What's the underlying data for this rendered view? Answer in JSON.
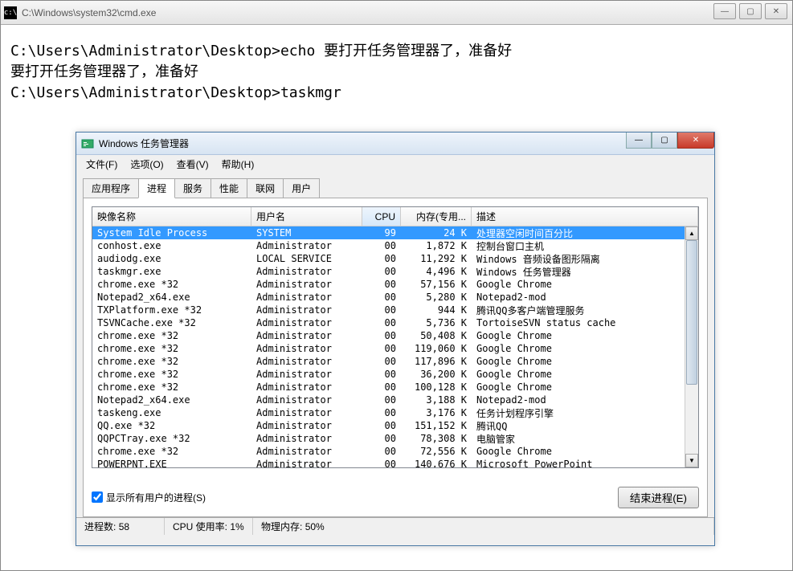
{
  "cmd": {
    "title": "C:\\Windows\\system32\\cmd.exe",
    "lines": [
      "",
      "C:\\Users\\Administrator\\Desktop>echo 要打开任务管理器了，准备好",
      "要打开任务管理器了，准备好",
      "",
      "C:\\Users\\Administrator\\Desktop>taskmgr"
    ]
  },
  "tm": {
    "title": "Windows 任务管理器",
    "menu": [
      "文件(F)",
      "选项(O)",
      "查看(V)",
      "帮助(H)"
    ],
    "tabs": [
      "应用程序",
      "进程",
      "服务",
      "性能",
      "联网",
      "用户"
    ],
    "active_tab": 1,
    "columns": {
      "name": "映像名称",
      "user": "用户名",
      "cpu": "CPU",
      "mem": "内存(专用...",
      "desc": "描述"
    },
    "rows": [
      {
        "name": "System Idle Process",
        "user": "SYSTEM",
        "cpu": "99",
        "mem": "24 K",
        "desc": "处理器空闲时间百分比",
        "selected": true
      },
      {
        "name": "conhost.exe",
        "user": "Administrator",
        "cpu": "00",
        "mem": "1,872 K",
        "desc": "控制台窗口主机"
      },
      {
        "name": "audiodg.exe",
        "user": "LOCAL SERVICE",
        "cpu": "00",
        "mem": "11,292 K",
        "desc": "Windows 音频设备图形隔离"
      },
      {
        "name": "taskmgr.exe",
        "user": "Administrator",
        "cpu": "00",
        "mem": "4,496 K",
        "desc": "Windows 任务管理器"
      },
      {
        "name": "chrome.exe *32",
        "user": "Administrator",
        "cpu": "00",
        "mem": "57,156 K",
        "desc": "Google Chrome"
      },
      {
        "name": "Notepad2_x64.exe",
        "user": "Administrator",
        "cpu": "00",
        "mem": "5,280 K",
        "desc": "Notepad2-mod"
      },
      {
        "name": "TXPlatform.exe *32",
        "user": "Administrator",
        "cpu": "00",
        "mem": "944 K",
        "desc": "腾讯QQ多客户端管理服务"
      },
      {
        "name": "TSVNCache.exe *32",
        "user": "Administrator",
        "cpu": "00",
        "mem": "5,736 K",
        "desc": "TortoiseSVN status cache"
      },
      {
        "name": "chrome.exe *32",
        "user": "Administrator",
        "cpu": "00",
        "mem": "50,408 K",
        "desc": "Google Chrome"
      },
      {
        "name": "chrome.exe *32",
        "user": "Administrator",
        "cpu": "00",
        "mem": "119,060 K",
        "desc": "Google Chrome"
      },
      {
        "name": "chrome.exe *32",
        "user": "Administrator",
        "cpu": "00",
        "mem": "117,896 K",
        "desc": "Google Chrome"
      },
      {
        "name": "chrome.exe *32",
        "user": "Administrator",
        "cpu": "00",
        "mem": "36,200 K",
        "desc": "Google Chrome"
      },
      {
        "name": "chrome.exe *32",
        "user": "Administrator",
        "cpu": "00",
        "mem": "100,128 K",
        "desc": "Google Chrome"
      },
      {
        "name": "Notepad2_x64.exe",
        "user": "Administrator",
        "cpu": "00",
        "mem": "3,188 K",
        "desc": "Notepad2-mod"
      },
      {
        "name": "taskeng.exe",
        "user": "Administrator",
        "cpu": "00",
        "mem": "3,176 K",
        "desc": "任务计划程序引擎"
      },
      {
        "name": "QQ.exe *32",
        "user": "Administrator",
        "cpu": "00",
        "mem": "151,152 K",
        "desc": "腾讯QQ"
      },
      {
        "name": "QQPCTray.exe *32",
        "user": "Administrator",
        "cpu": "00",
        "mem": "78,308 K",
        "desc": "电脑管家"
      },
      {
        "name": "chrome.exe *32",
        "user": "Administrator",
        "cpu": "00",
        "mem": "72,556 K",
        "desc": "Google Chrome"
      },
      {
        "name": "POWERPNT.EXE",
        "user": "Administrator",
        "cpu": "00",
        "mem": "140,676 K",
        "desc": "Microsoft PowerPoint"
      }
    ],
    "show_all_label": "显示所有用户的进程(S)",
    "show_all_checked": true,
    "end_process_label": "结束进程(E)",
    "status": {
      "processes_label": "进程数:",
      "processes": "58",
      "cpu_label": "CPU 使用率:",
      "cpu": "1%",
      "mem_label": "物理内存:",
      "mem": "50%"
    }
  }
}
